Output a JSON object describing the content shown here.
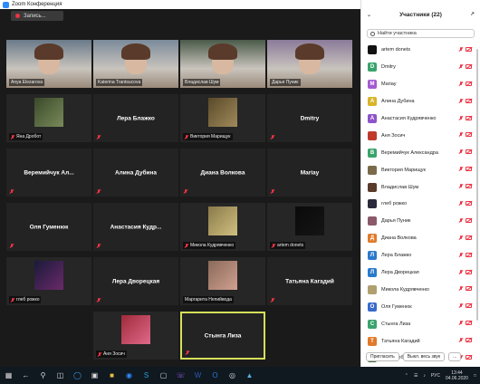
{
  "window": {
    "title": "Zoom Конференция"
  },
  "recording": {
    "label": "Запись..."
  },
  "tiles": [
    {
      "name": "Anya Elezarova",
      "type": "video",
      "muted": false
    },
    {
      "name": "Katerina Trantsucova",
      "type": "video",
      "muted": false
    },
    {
      "name": "Владислав Шум",
      "type": "video",
      "muted": false
    },
    {
      "name": "Дарья Пуник",
      "type": "video",
      "muted": false
    },
    {
      "name": "Яна Дробот",
      "type": "photo",
      "muted": true
    },
    {
      "name": "Лера Блажко",
      "type": "text",
      "muted": true
    },
    {
      "name": "Виктория Марищук",
      "type": "photo",
      "muted": true
    },
    {
      "name": "Dmitry",
      "type": "text",
      "muted": true
    },
    {
      "name": "Веремийчук Ал...",
      "type": "text",
      "muted": true
    },
    {
      "name": "Алина Дубина",
      "type": "text",
      "muted": true
    },
    {
      "name": "Диана Волкова",
      "type": "text",
      "muted": true
    },
    {
      "name": "Mariay",
      "type": "text",
      "muted": true
    },
    {
      "name": "Оля Гуменюк",
      "type": "text",
      "muted": true
    },
    {
      "name": "Анастасия Кудр...",
      "type": "text",
      "muted": true
    },
    {
      "name": "Микола Кудрявченко",
      "type": "photo",
      "muted": true
    },
    {
      "name": "artem donets",
      "type": "photo",
      "muted": true
    },
    {
      "name": "глеб рожко",
      "type": "photo",
      "muted": true
    },
    {
      "name": "Лера Дворецкая",
      "type": "text",
      "muted": true
    },
    {
      "name": "Маргарита Непийвода",
      "type": "photo",
      "muted": false
    },
    {
      "name": "Татьяна Кагадий",
      "type": "text",
      "muted": true
    },
    {
      "name": "Аня Зосич",
      "type": "photo",
      "muted": true
    },
    {
      "name": "Стынга Лиза",
      "type": "text",
      "muted": true,
      "highlighted": true
    }
  ],
  "panel": {
    "title": "Участники (22)",
    "search_placeholder": "Найти участника",
    "participants": [
      {
        "name": "artem donets",
        "initial": "",
        "color": "#111111"
      },
      {
        "name": "Dmitry",
        "initial": "D",
        "color": "#3aa36b"
      },
      {
        "name": "Mariay",
        "initial": "M",
        "color": "#a45bd1"
      },
      {
        "name": "Алина Дубина",
        "initial": "А",
        "color": "#d8b52a"
      },
      {
        "name": "Анастасия Кудрявченко",
        "initial": "А",
        "color": "#8e54c9"
      },
      {
        "name": "Аня Зосич",
        "initial": "",
        "color": "#c0392b"
      },
      {
        "name": "Веремийчук Александра",
        "initial": "В",
        "color": "#3aa36b"
      },
      {
        "name": "Виктория Марищук",
        "initial": "",
        "color": "#7a6a4a"
      },
      {
        "name": "Владислав Шум",
        "initial": "",
        "color": "#5a3a2a"
      },
      {
        "name": "глеб рожко",
        "initial": "",
        "color": "#2a2a3a"
      },
      {
        "name": "Дарья Пуник",
        "initial": "",
        "color": "#8a5a6a"
      },
      {
        "name": "Диана Волкова",
        "initial": "Д",
        "color": "#e07a2a"
      },
      {
        "name": "Лера Блажко",
        "initial": "Л",
        "color": "#2a7acb"
      },
      {
        "name": "Лера Дворецкая",
        "initial": "Л",
        "color": "#2a7acb"
      },
      {
        "name": "Микола Кудрявченко",
        "initial": "",
        "color": "#b0a070"
      },
      {
        "name": "Оля Гуменюк",
        "initial": "О",
        "color": "#3a6acb"
      },
      {
        "name": "Стынга Лиза",
        "initial": "С",
        "color": "#3aa36b"
      },
      {
        "name": "Татьяна Кагадий",
        "initial": "Т",
        "color": "#e07a2a"
      },
      {
        "name": "Яна Дробот",
        "initial": "",
        "color": "#4a6a3a"
      },
      {
        "name": "Маргарита Непийвода",
        "initial": "",
        "color": "#c09a8a"
      }
    ],
    "invite_label": "Пригласить",
    "mute_all_label": "Выкл. весь звук",
    "more_label": "..."
  },
  "taskbar": {
    "lang": "РУС",
    "time": "13:44",
    "date": "04.06.2020"
  }
}
